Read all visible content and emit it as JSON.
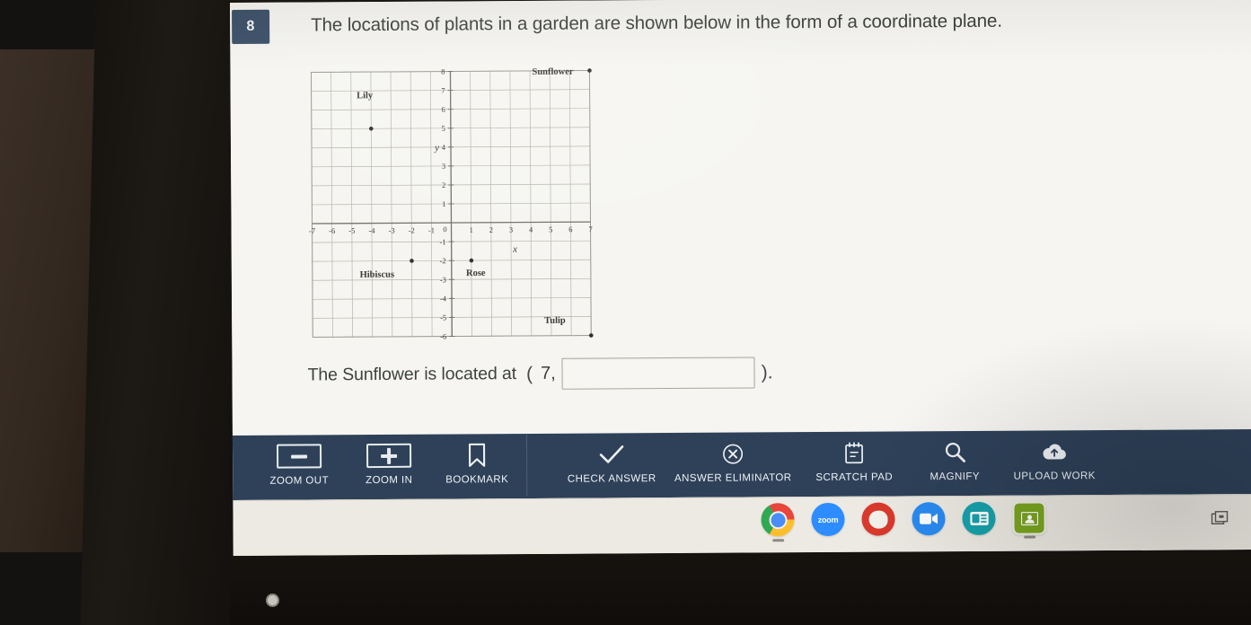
{
  "question": {
    "number": "8",
    "prompt": "The locations of plants in a garden are shown below in the form of a coordinate plane."
  },
  "answer_line": {
    "label": "The Sunflower is located at",
    "paren_open": "(",
    "x_value": "7,",
    "input_value": "",
    "input_placeholder": "",
    "paren_close": ")."
  },
  "chart_data": {
    "type": "scatter",
    "title": "",
    "xlabel": "x",
    "ylabel": "y",
    "xlim": [
      -7,
      7
    ],
    "ylim": [
      -6,
      8
    ],
    "grid": true,
    "x_ticks": [
      "-7",
      "-6",
      "-5",
      "-4",
      "-3",
      "-2",
      "0",
      "1",
      "2",
      "3",
      "4",
      "5",
      "6",
      "7"
    ],
    "y_ticks": [
      "8",
      "7",
      "6",
      "5",
      "4",
      "3",
      "2",
      "1",
      "0",
      "-1",
      "-2",
      "-3",
      "-4",
      "-5",
      "-6"
    ],
    "origin_label": "0",
    "points": [
      {
        "label": "Sunflower",
        "x": 7,
        "y": 8,
        "label_dx": -64,
        "label_dy": 4
      },
      {
        "label": "Lily",
        "x": -4,
        "y": 5,
        "label_dx": -16,
        "label_dy": -34
      },
      {
        "label": "Hibiscus",
        "x": -2,
        "y": -2,
        "label_dx": -58,
        "label_dy": 18
      },
      {
        "label": "Rose",
        "x": 1,
        "y": -2,
        "label_dx": -6,
        "label_dy": 17
      },
      {
        "label": "Tulip",
        "x": 7,
        "y": -6,
        "label_dx": -52,
        "label_dy": -14
      }
    ]
  },
  "toolbar": {
    "items": [
      {
        "id": "zoom-out",
        "label": "ZOOM OUT",
        "icon": "minus-box-icon"
      },
      {
        "id": "zoom-in",
        "label": "ZOOM IN",
        "icon": "plus-box-icon"
      },
      {
        "id": "bookmark",
        "label": "BOOKMARK",
        "icon": "bookmark-icon"
      },
      {
        "id": "check-answer",
        "label": "CHECK ANSWER",
        "icon": "checkmark-icon"
      },
      {
        "id": "answer-eliminator",
        "label": "ANSWER ELIMINATOR",
        "icon": "circle-x-icon"
      },
      {
        "id": "scratch-pad",
        "label": "SCRATCH PAD",
        "icon": "notepad-icon"
      },
      {
        "id": "magnify",
        "label": "MAGNIFY",
        "icon": "magnifier-icon"
      },
      {
        "id": "upload-work",
        "label": "UPLOAD WORK",
        "icon": "cloud-upload-icon"
      }
    ],
    "accent_bg": "#2e4159",
    "label_color": "#f0f2f5"
  },
  "shelf": {
    "apps": [
      {
        "id": "chrome",
        "icon": "chrome-icon",
        "text": "",
        "active": true
      },
      {
        "id": "zoom",
        "icon": "zoom-icon",
        "text": "zoom",
        "active": false
      },
      {
        "id": "red-app",
        "icon": "red-circle-app-icon",
        "text": "",
        "active": false
      },
      {
        "id": "meet",
        "icon": "video-camera-icon",
        "text": "",
        "active": false
      },
      {
        "id": "teal-app",
        "icon": "presentation-icon",
        "text": "",
        "active": false
      },
      {
        "id": "google-classroom",
        "icon": "classroom-icon",
        "text": "",
        "active": true
      }
    ],
    "status_icon": "display-windows-icon"
  }
}
